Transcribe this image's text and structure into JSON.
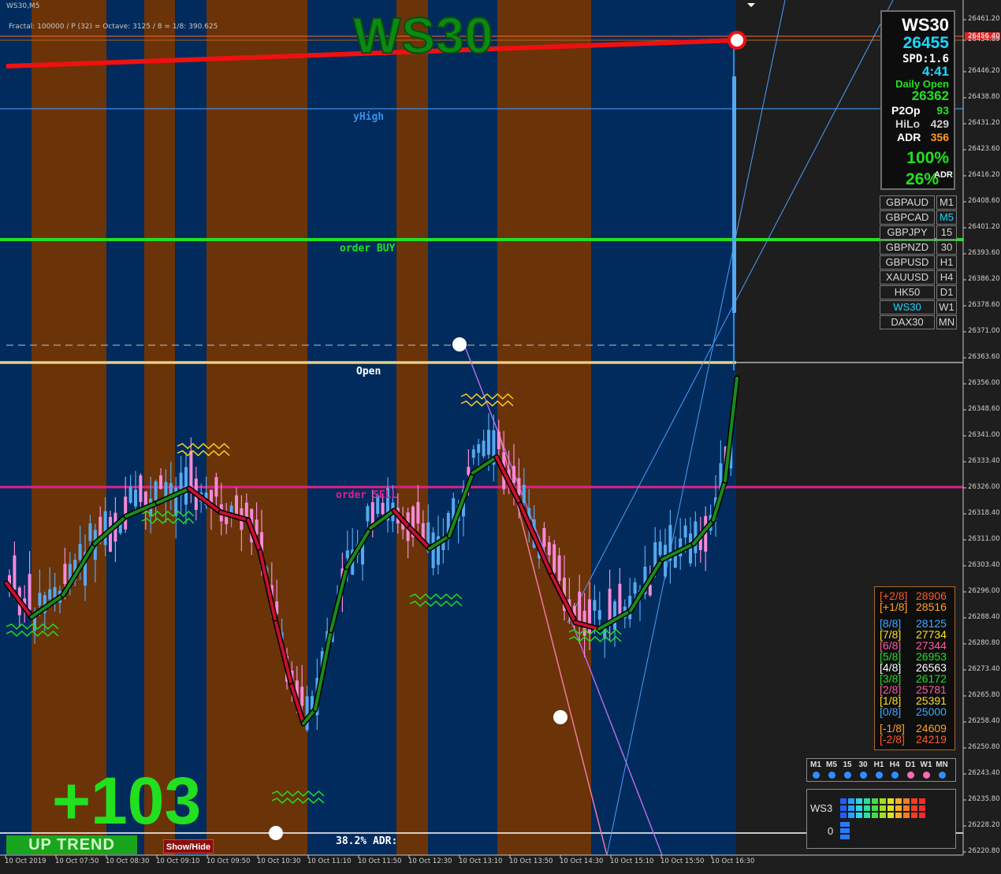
{
  "window": {
    "title": "WS30,M5"
  },
  "header": {
    "fractal_text": "Fractal: 100000 / P (32) = Octave: 3125 / 8 = 1/8: 390.625",
    "big_title": "WS30"
  },
  "lines": {
    "yhigh": "yHigh",
    "order_buy": "order BUY",
    "open": "Open",
    "order_sell": "order SELL",
    "adr_382": "38.2% ADR:"
  },
  "score": {
    "value": "+103"
  },
  "trend": {
    "label": "UP TREND"
  },
  "buttons": {
    "show_hide": "Show/Hide"
  },
  "info_panel": {
    "symbol": "WS30",
    "price": "26455",
    "spread": "SPD:1.6",
    "timer": "4:41",
    "daily_open_label": "Daily Open",
    "daily_open": "26362",
    "p2op_label": "P2Op",
    "p2op": "93",
    "hilo_label": "HiLo",
    "hilo": "429",
    "adr_label": "ADR",
    "adr": "356",
    "pct1": "100%",
    "pct2": "26%",
    "pct2_suffix": "ADR"
  },
  "symbols": [
    {
      "name": "GBPAUD",
      "tf": "M1"
    },
    {
      "name": "GBPCAD",
      "tf": "M5"
    },
    {
      "name": "GBPJPY",
      "tf": "15"
    },
    {
      "name": "GBPNZD",
      "tf": "30"
    },
    {
      "name": "GBPUSD",
      "tf": "H1"
    },
    {
      "name": "XAUUSD",
      "tf": "H4"
    },
    {
      "name": "HK50",
      "tf": "D1"
    },
    {
      "name": "WS30",
      "tf": "W1"
    },
    {
      "name": "DAX30",
      "tf": "MN"
    }
  ],
  "murrey_levels": [
    {
      "tag": "[+2/8]",
      "value": "28906",
      "color": "#ff5a2a"
    },
    {
      "tag": "[+1/8]",
      "value": "28516",
      "color": "#ffa02a"
    },
    {
      "tag": "[8/8]",
      "value": "28125",
      "color": "#3ea8ff"
    },
    {
      "tag": "[7/8]",
      "value": "27734",
      "color": "#ffe020"
    },
    {
      "tag": "[6/8]",
      "value": "27344",
      "color": "#ff5aa0"
    },
    {
      "tag": "[5/8]",
      "value": "26953",
      "color": "#20e020"
    },
    {
      "tag": "[4/8]",
      "value": "26563",
      "color": "#ffffff"
    },
    {
      "tag": "[3/8]",
      "value": "26172",
      "color": "#20e020"
    },
    {
      "tag": "[2/8]",
      "value": "25781",
      "color": "#ff5aa0"
    },
    {
      "tag": "[1/8]",
      "value": "25391",
      "color": "#ffe020"
    },
    {
      "tag": "[0/8]",
      "value": "25000",
      "color": "#3ea8ff"
    },
    {
      "tag": "[-1/8]",
      "value": "24609",
      "color": "#ffa02a"
    },
    {
      "tag": "[-2/8]",
      "value": "24219",
      "color": "#ff5a2a"
    }
  ],
  "tf_strength": {
    "labels": [
      "M1",
      "M5",
      "15",
      "30",
      "H1",
      "H4",
      "D1",
      "W1",
      "MN"
    ],
    "colors": [
      "#2f8fff",
      "#2f8fff",
      "#2f8fff",
      "#2f8fff",
      "#2f8fff",
      "#2f8fff",
      "#ff69b4",
      "#ff69b4",
      "#2f8fff"
    ]
  },
  "strength_meter": {
    "symbol": "WS3",
    "value": "0"
  },
  "price_axis": [
    "26461.20",
    "26454.89",
    "26446.20",
    "26438.80",
    "26431.20",
    "26423.60",
    "26416.20",
    "26408.60",
    "26401.20",
    "26393.60",
    "26386.20",
    "26378.60",
    "26371.00",
    "26363.60",
    "26356.00",
    "26348.60",
    "26341.00",
    "26333.40",
    "26326.00",
    "26318.40",
    "26311.00",
    "26303.40",
    "26296.00",
    "26288.40",
    "26280.80",
    "26273.40",
    "26265.80",
    "26258.40",
    "26250.80",
    "26243.40",
    "26235.80",
    "26228.20",
    "26220.80"
  ],
  "current_price_tag": "26456.40",
  "time_axis": [
    "10 Oct 2019",
    "10 Oct 07:50",
    "10 Oct 08:30",
    "10 Oct 09:10",
    "10 Oct 09:50",
    "10 Oct 10:30",
    "10 Oct 11:10",
    "10 Oct 11:50",
    "10 Oct 12:30",
    "10 Oct 13:10",
    "10 Oct 13:50",
    "10 Oct 14:30",
    "10 Oct 15:10",
    "10 Oct 15:50",
    "10 Oct 16:30"
  ],
  "colors": {
    "bg_blue": "#002b5c",
    "bg_brown": "#6b3308",
    "bull": "#55a9ef",
    "bear": "#f58ad8",
    "accent_green": "#22e020"
  }
}
